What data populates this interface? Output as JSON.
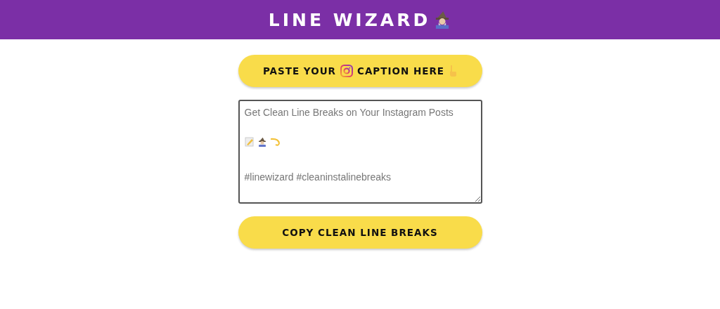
{
  "header": {
    "title": "LINE WIZARD"
  },
  "paste_button": {
    "label_start": "PASTE YOUR",
    "label_end": "CAPTION HERE"
  },
  "caption_field": {
    "placeholder_top": "Get Clean Line Breaks on Your Instagram Posts",
    "placeholder_bottom": "#linewizard #cleaninstalinebreaks"
  },
  "copy_button": {
    "label": "COPY CLEAN LINE BREAKS"
  }
}
